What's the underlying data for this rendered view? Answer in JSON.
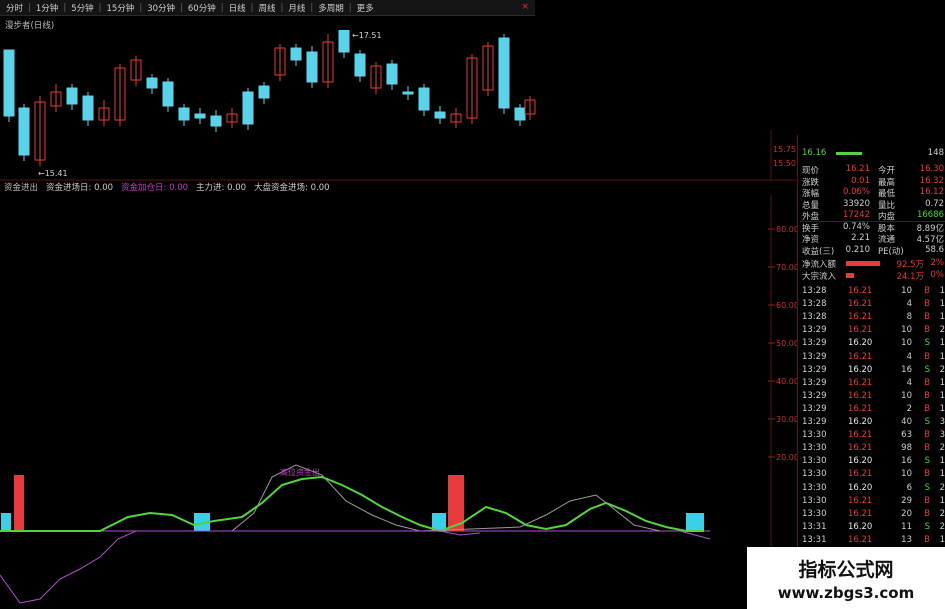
{
  "toolbar": {
    "items": [
      "分时",
      "1分钟",
      "5分钟",
      "15分钟",
      "30分钟",
      "60分钟",
      "日线",
      "周线",
      "月线",
      "多周期",
      "更多"
    ],
    "close_glyph": "×"
  },
  "upper": {
    "title": "漫步者(日线)",
    "high_label": "17.51",
    "low_label": "15.41",
    "scale_labels": [
      "15.75",
      "15.50"
    ],
    "bull_color": "#e83a3a",
    "bear_color": "#5ad4e8"
  },
  "indicator": {
    "header": [
      {
        "text": "资金进出",
        "color": "#bbbbbb"
      },
      {
        "text": "资金进场日: 0.00",
        "color": "#cccccc"
      },
      {
        "text": "资金加仓日: 0.00",
        "color": "#c040c0"
      },
      {
        "text": "主力进: 0.00",
        "color": "#cccccc"
      },
      {
        "text": "大盘资金进场: 0.00",
        "color": "#cccccc"
      }
    ],
    "annotation": "高位资金出",
    "scale_labels": [
      "80.00",
      "70.00",
      "60.00",
      "50.00",
      "40.00",
      "30.00",
      "20.00"
    ],
    "green_color": "#52d43a",
    "violet_color": "#b050d0",
    "gray_color": "#9a9a9a"
  },
  "quote": {
    "top_row": {
      "price": "16.16",
      "right": "148"
    },
    "rows": [
      {
        "l1": "现价",
        "v1": "16.21",
        "l2": "今开",
        "v2": "16.30"
      },
      {
        "l1": "涨跌",
        "v1": "0.01",
        "l2": "最高",
        "v2": "16.32"
      },
      {
        "l1": "涨幅",
        "v1": "0.06%",
        "l2": "最低",
        "v2": "16.12"
      },
      {
        "l1": "总量",
        "v1": "33920",
        "l2": "量比",
        "v2": "0.72"
      },
      {
        "l1": "外盘",
        "v1": "17242",
        "l2": "内盘",
        "v2": "16686"
      },
      {
        "l1": "换手",
        "v1": "0.74%",
        "l2": "股本",
        "v2": "8.89亿"
      },
      {
        "l1": "净资",
        "v1": "2.21",
        "l2": "流通",
        "v2": "4.57亿"
      },
      {
        "l1": "收益(三)",
        "v1": "0.210",
        "l2": "PE(动)",
        "v2": "58.6"
      }
    ],
    "flows": [
      {
        "label": "净流入额",
        "value": "92.5万",
        "pct": "2%"
      },
      {
        "label": "大宗流入",
        "value": "24.1万",
        "pct": "0%"
      }
    ],
    "trades": [
      {
        "t": "13:28",
        "p": "16.21",
        "v": "10",
        "s": "B",
        "n": "1"
      },
      {
        "t": "13:28",
        "p": "16.21",
        "v": "4",
        "s": "B",
        "n": "1"
      },
      {
        "t": "13:28",
        "p": "16.21",
        "v": "8",
        "s": "B",
        "n": "1"
      },
      {
        "t": "13:29",
        "p": "16.21",
        "v": "10",
        "s": "B",
        "n": "2"
      },
      {
        "t": "13:29",
        "p": "16.20",
        "v": "10",
        "s": "S",
        "n": "1"
      },
      {
        "t": "13:29",
        "p": "16.21",
        "v": "4",
        "s": "B",
        "n": "1"
      },
      {
        "t": "13:29",
        "p": "16.20",
        "v": "16",
        "s": "S",
        "n": "2"
      },
      {
        "t": "13:29",
        "p": "16.21",
        "v": "4",
        "s": "B",
        "n": "1"
      },
      {
        "t": "13:29",
        "p": "16.21",
        "v": "10",
        "s": "B",
        "n": "1"
      },
      {
        "t": "13:29",
        "p": "16.21",
        "v": "2",
        "s": "B",
        "n": "1"
      },
      {
        "t": "13:29",
        "p": "16.20",
        "v": "40",
        "s": "S",
        "n": "3"
      },
      {
        "t": "13:30",
        "p": "16.21",
        "v": "63",
        "s": "B",
        "n": "3"
      },
      {
        "t": "13:30",
        "p": "16.21",
        "v": "98",
        "s": "B",
        "n": "2"
      },
      {
        "t": "13:30",
        "p": "16.20",
        "v": "16",
        "s": "S",
        "n": "1"
      },
      {
        "t": "13:30",
        "p": "16.21",
        "v": "10",
        "s": "B",
        "n": "1"
      },
      {
        "t": "13:30",
        "p": "16.20",
        "v": "6",
        "s": "S",
        "n": "2"
      },
      {
        "t": "13:30",
        "p": "16.21",
        "v": "29",
        "s": "B",
        "n": "1"
      },
      {
        "t": "13:30",
        "p": "16.21",
        "v": "20",
        "s": "B",
        "n": "2"
      },
      {
        "t": "13:31",
        "p": "16.20",
        "v": "11",
        "s": "S",
        "n": "2"
      },
      {
        "t": "13:31",
        "p": "16.21",
        "v": "13",
        "s": "B",
        "n": "1"
      }
    ]
  },
  "watermark": {
    "line1": "指标公式网",
    "line2": "www.zbgs3.com"
  }
}
